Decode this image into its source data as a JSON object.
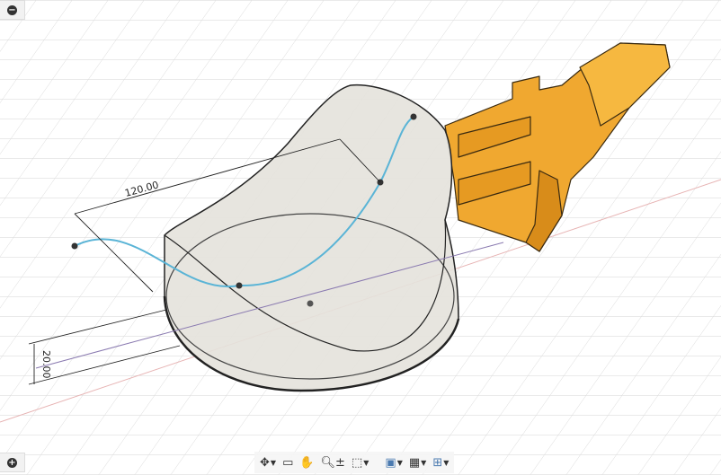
{
  "viewport": {
    "dimensions": [
      "120.00",
      "20.00"
    ],
    "colors": {
      "body": "#f0a830",
      "sketch": "#5ab4d6",
      "shell": "#e6e4de"
    }
  },
  "corner_buttons": {
    "collapse": "−",
    "expand": "+"
  },
  "toolbar": [
    {
      "name": "orbit",
      "icon": "orbit-icon",
      "dropdown": true
    },
    {
      "name": "look-at",
      "icon": "look-at-icon",
      "dropdown": false
    },
    {
      "name": "pan",
      "icon": "pan-hand-icon",
      "dropdown": false
    },
    {
      "name": "zoom",
      "icon": "zoom-icon",
      "dropdown": false
    },
    {
      "name": "fit",
      "icon": "zoom-window-icon",
      "dropdown": true
    },
    {
      "name": "display-settings",
      "icon": "display-icon",
      "dropdown": true
    },
    {
      "name": "grid-snaps",
      "icon": "grid-icon",
      "dropdown": true
    },
    {
      "name": "viewports",
      "icon": "viewports-icon",
      "dropdown": true
    }
  ]
}
